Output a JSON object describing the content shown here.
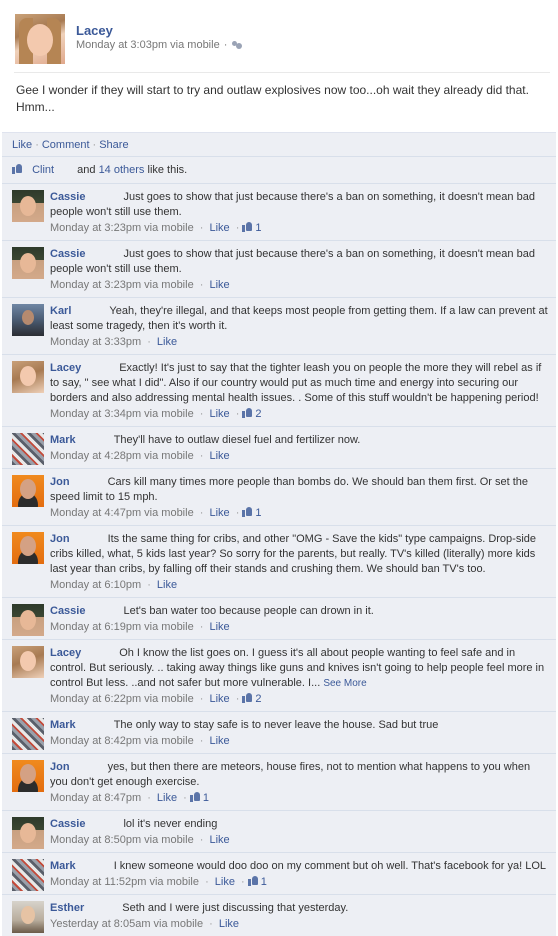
{
  "post": {
    "author": "Lacey",
    "timestamp": "Monday at 3:03pm via mobile",
    "separator": "·",
    "text": "Gee I wonder if they will start to try and outlaw explosives now too...oh wait they already did that. Hmm..."
  },
  "actions": {
    "like": "Like",
    "comment": "Comment",
    "share": "Share",
    "separator": "·"
  },
  "likes": {
    "first_liker": "Clint",
    "and": "and",
    "others": "14 others",
    "suffix": "like this."
  },
  "comments": [
    {
      "author": "Cassie",
      "avatar": "cassie",
      "text": "Just goes to show that just because there's a ban on something, it doesn't mean bad people won't still use them.",
      "time": "Monday at 3:23pm via mobile",
      "like_label": "Like",
      "likes": "1"
    },
    {
      "author": "Cassie",
      "avatar": "cassie",
      "text": "Just goes to show that just because there's a ban on something, it doesn't mean bad people won't still use them.",
      "time": "Monday at 3:23pm via mobile",
      "like_label": "Like",
      "likes": ""
    },
    {
      "author": "Karl",
      "avatar": "karl",
      "text": "Yeah, they're illegal, and that keeps most people from getting them. If a law can prevent at least some tragedy, then it's worth it.",
      "time": "Monday at 3:33pm",
      "like_label": "Like",
      "likes": ""
    },
    {
      "author": "Lacey",
      "avatar": "lacey",
      "text": "Exactly! It's just to say that the tighter leash you on people the more they will rebel as if to say, \" see what I did\". Also if our country would put as much time and energy into securing our borders and also addressing mental health issues. . Some of this stuff wouldn't be happening period!",
      "time": "Monday at 3:34pm via mobile",
      "like_label": "Like",
      "likes": "2"
    },
    {
      "author": "Mark",
      "avatar": "mark",
      "text": "They'll have to outlaw diesel fuel and fertilizer now.",
      "time": "Monday at 4:28pm via mobile",
      "like_label": "Like",
      "likes": ""
    },
    {
      "author": "Jon",
      "avatar": "jon",
      "text": "Cars kill many times more people than bombs do. We should ban them first. Or set the speed limit to 15 mph.",
      "time": "Monday at 4:47pm via mobile",
      "like_label": "Like",
      "likes": "1"
    },
    {
      "author": "Jon",
      "avatar": "jon",
      "text": "Its the same thing for cribs, and other \"OMG - Save the kids\" type campaigns. Drop-side cribs killed, what, 5 kids last year? So sorry for the parents, but really. TV's killed (literally) more kids last year than cribs, by falling off their stands and crushing them. We should ban TV's too.",
      "time": "Monday at 6:10pm",
      "like_label": "Like",
      "likes": ""
    },
    {
      "author": "Cassie",
      "avatar": "cassie",
      "text": "Let's ban water too because people can drown in it.",
      "time": "Monday at 6:19pm via mobile",
      "like_label": "Like",
      "likes": ""
    },
    {
      "author": "Lacey",
      "avatar": "lacey",
      "text": "Oh I know the list goes on. I guess it's all about people wanting to feel safe and in control. But seriously. .. taking away things like guns and knives isn't going to help people feel more in control But less. ..and not safer but more vulnerable. I...",
      "see_more": "See More",
      "time": "Monday at 6:22pm via mobile",
      "like_label": "Like",
      "likes": "2"
    },
    {
      "author": "Mark",
      "avatar": "mark",
      "text": "The only way to stay safe is to never leave the house. Sad but true",
      "time": "Monday at 8:42pm via mobile",
      "like_label": "Like",
      "likes": ""
    },
    {
      "author": "Jon",
      "avatar": "jon",
      "text": "yes, but then there are meteors, house fires, not to mention what happens to you when you don't get enough exercise.",
      "time": "Monday at 8:47pm",
      "like_label": "Like",
      "likes": "1"
    },
    {
      "author": "Cassie",
      "avatar": "cassie",
      "text": "lol it's never ending",
      "time": "Monday at 8:50pm via mobile",
      "like_label": "Like",
      "likes": ""
    },
    {
      "author": "Mark",
      "avatar": "mark",
      "text": "I knew someone would doo doo on my comment but oh well. That's facebook for ya! LOL",
      "time": "Monday at 11:52pm via mobile",
      "like_label": "Like",
      "likes": "1"
    },
    {
      "author": "Esther",
      "avatar": "esther",
      "text": "Seth and I were just discussing that yesterday.",
      "time": "Yesterday at 8:05am via mobile",
      "like_label": "Like",
      "likes": ""
    }
  ],
  "colors": {
    "link": "#3b5998",
    "panel_bg": "#edeff4",
    "divider": "#d8dfea",
    "meta_text": "#777777"
  }
}
